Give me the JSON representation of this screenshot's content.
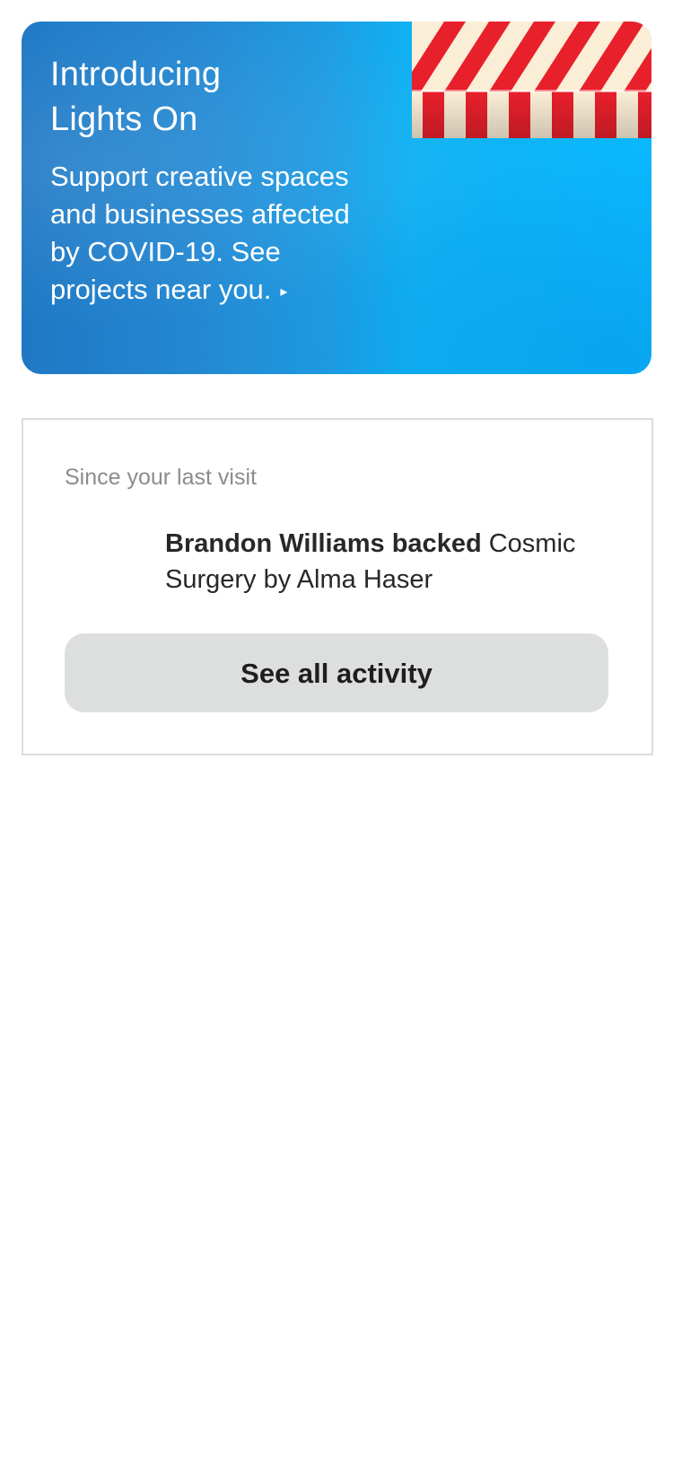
{
  "banner": {
    "title_line1": "Introducing",
    "title_line2": "Lights On",
    "body": "Support creative spaces and businesses affected by COVID-19. See projects near you.",
    "arrow": "▸",
    "colors": {
      "gradient_start": "#1f78c4",
      "gradient_end": "#0ab8fd",
      "awning_red": "#e8202c",
      "awning_cream": "#fbeed6"
    },
    "illustration": "striped-awning-icon"
  },
  "activity": {
    "section_label": "Since your last visit",
    "items": [
      {
        "actor_text": "Brandon Williams backed",
        "project_text": "Cosmic Surgery by Alma Haser"
      }
    ],
    "button_label": "See all activity"
  }
}
